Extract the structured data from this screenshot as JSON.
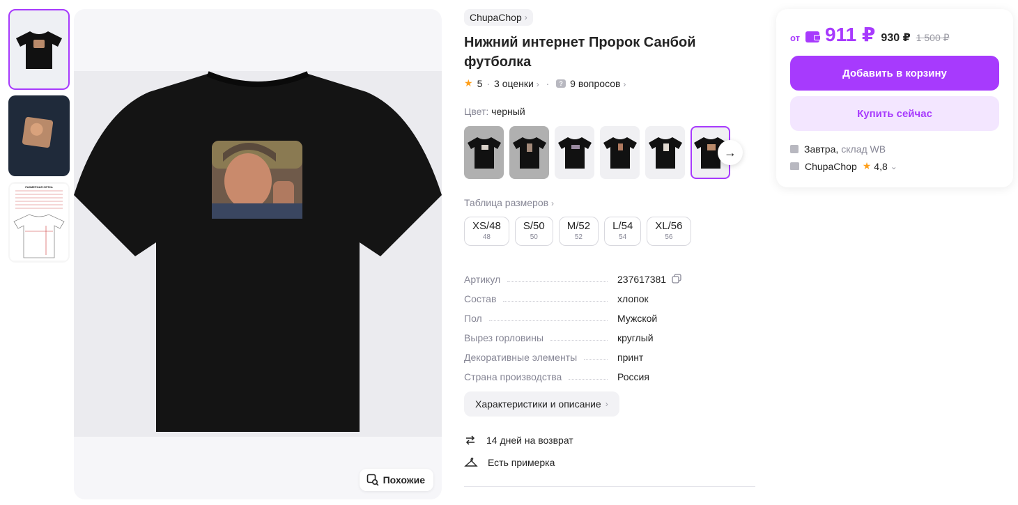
{
  "gallery": {
    "thumbnails": [
      {
        "kind": "tshirt-front"
      },
      {
        "kind": "tshirt-print-closeup"
      },
      {
        "kind": "size-chart",
        "caption": "РАЗМЕРНАЯ СЕТКА"
      }
    ],
    "similar_label": "Похожие"
  },
  "product": {
    "brand": "ChupaChop",
    "title": "Нижний интернет Пророк Санбой футболка",
    "rating": "5",
    "reviews": "3 оценки",
    "questions": "9 вопросов",
    "color_label": "Цвет:",
    "color_value": "черный",
    "size_table_link": "Таблица размеров",
    "sizes": [
      {
        "label": "XS/48",
        "ru": "48"
      },
      {
        "label": "S/50",
        "ru": "50"
      },
      {
        "label": "M/52",
        "ru": "52"
      },
      {
        "label": "L/54",
        "ru": "54"
      },
      {
        "label": "XL/56",
        "ru": "56"
      }
    ],
    "specs": [
      {
        "key": "Артикул",
        "value": "237617381"
      },
      {
        "key": "Состав",
        "value": "хлопок"
      },
      {
        "key": "Пол",
        "value": "Мужской"
      },
      {
        "key": "Вырез горловины",
        "value": "круглый"
      },
      {
        "key": "Декоративные элементы",
        "value": "принт"
      },
      {
        "key": "Страна производства",
        "value": "Россия"
      }
    ],
    "characteristics_button": "Характеристики и описание",
    "perks": [
      {
        "icon": "return-icon",
        "text": "14 дней на возврат"
      },
      {
        "icon": "hanger-icon",
        "text": "Есть примерка"
      }
    ]
  },
  "buybox": {
    "from": "от",
    "price": "911 ₽",
    "price_secondary": "930 ₽",
    "price_old": "1 500 ₽",
    "add_to_cart": "Добавить в корзину",
    "buy_now": "Купить сейчас",
    "delivery_day": "Завтра,",
    "delivery_place": "склад WB",
    "seller_name": "ChupaChop",
    "seller_rating": "4,8"
  },
  "colors": {
    "accent": "#a73afd",
    "accent_light": "#f3e6ff",
    "star": "#ff9f1a"
  }
}
